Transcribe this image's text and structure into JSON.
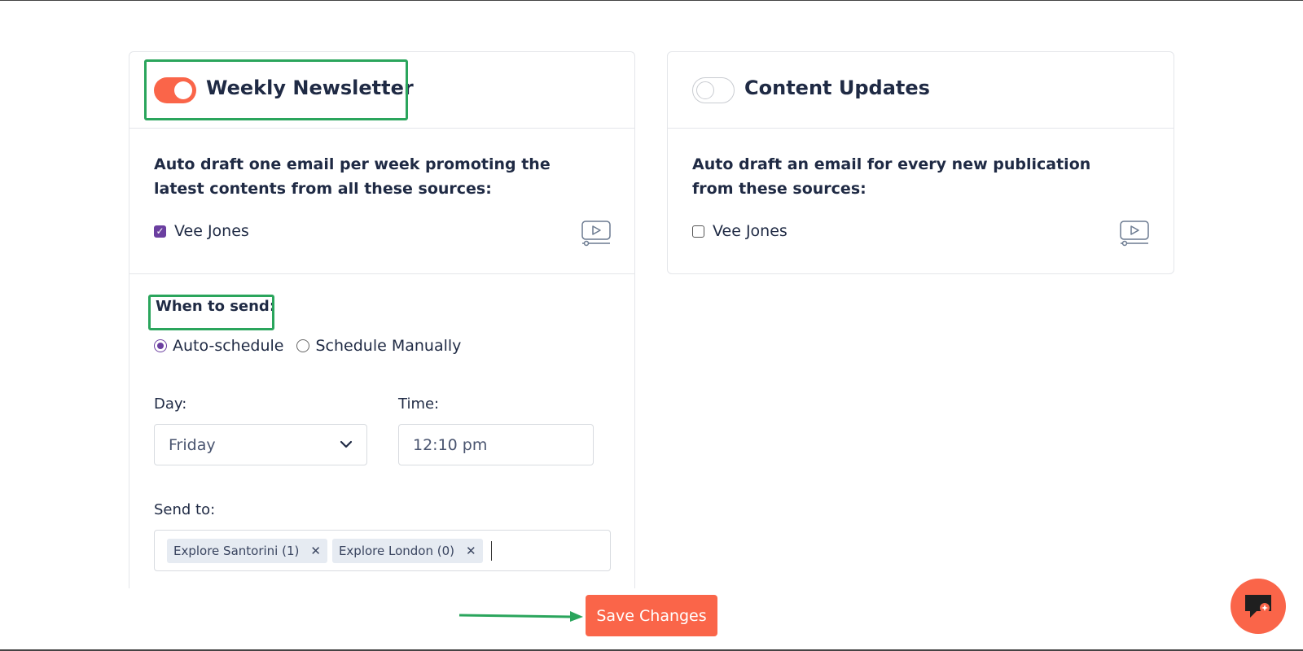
{
  "cards": {
    "weekly": {
      "title": "Weekly Newsletter",
      "enabled": true,
      "description": "Auto draft one email per week promoting the latest contents from all these sources:",
      "source": {
        "label": "Vee Jones",
        "checked": true
      },
      "when_label": "When to send:",
      "radio_options": [
        {
          "label": "Auto-schedule",
          "checked": true
        },
        {
          "label": "Schedule Manually",
          "checked": false
        }
      ],
      "day_label": "Day:",
      "day_value": "Friday",
      "time_label": "Time:",
      "time_value": "12:10 pm",
      "send_to_label": "Send to:",
      "send_to_tags": [
        "Explore Santorini (1)",
        "Explore London (0)"
      ]
    },
    "content": {
      "title": "Content Updates",
      "enabled": false,
      "description": "Auto draft an email for every new publication from these sources:",
      "source": {
        "label": "Vee Jones",
        "checked": false
      }
    }
  },
  "footer": {
    "save_label": "Save Changes"
  },
  "icons": {
    "video": "video-play-icon",
    "chevron": "chevron-down-icon",
    "chat": "chat-icon"
  },
  "colors": {
    "accent": "#fa6549",
    "checkbox": "#6b3fa0",
    "highlight": "#2aa55c"
  }
}
